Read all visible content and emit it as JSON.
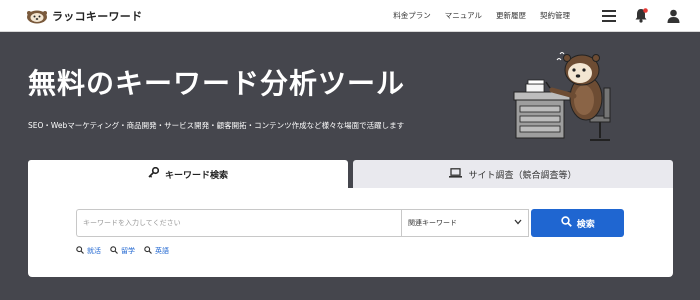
{
  "header": {
    "logo_text": "ラッコキーワード",
    "nav": [
      "料金プラン",
      "マニュアル",
      "更新履歴",
      "契約管理"
    ],
    "icons": [
      "menu-icon",
      "bell-icon",
      "user-icon"
    ],
    "notification_dot_color": "#e53935"
  },
  "hero": {
    "title": "無料のキーワード分析ツール",
    "subtitle": "SEO・Webマーケティング・商品開発・サービス開発・顧客開拓・コンテンツ作成など様々な場面で活躍します"
  },
  "tabs": [
    {
      "label": "キーワード検索",
      "icon": "key-icon",
      "active": true
    },
    {
      "label": "サイト調査（競合調査等）",
      "icon": "laptop-icon",
      "active": false
    }
  ],
  "search": {
    "placeholder": "キーワードを入力してください",
    "value": "",
    "select_value": "関連キーワード",
    "button_label": "検索",
    "suggestions": [
      "就活",
      "留学",
      "英語"
    ]
  },
  "colors": {
    "background": "#45464d",
    "accent": "#1f66d1"
  }
}
